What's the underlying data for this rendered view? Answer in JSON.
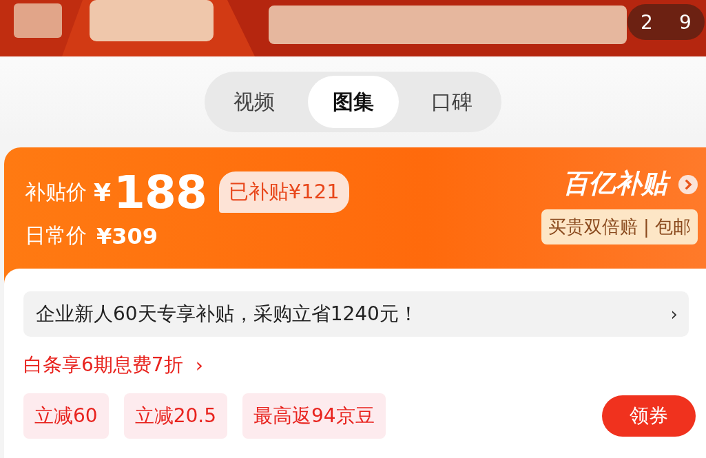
{
  "banner": {
    "kind": "picture",
    "counter": {
      "current": "2",
      "total": "9"
    }
  },
  "tabs": [
    {
      "label": "视频",
      "selected": false
    },
    {
      "label": "图集",
      "selected": true
    },
    {
      "label": "口碑",
      "selected": false
    }
  ],
  "price_card": {
    "subsidy_label": "补贴价",
    "currency": "¥",
    "subsidy_price": "188",
    "subsidized_tag": "已补贴¥121",
    "daily_label": "日常价",
    "daily_price": "¥309",
    "brand": "百亿补贴",
    "guarantee": "买贵双倍赔 | 包邮"
  },
  "promo_bar": {
    "text": "企业新人60天专享补贴，采购立省1240元！",
    "chevron": "›"
  },
  "installment": {
    "text": "白条享6期息费7折",
    "chevron": "›"
  },
  "coupons": [
    "立减60",
    "立减20.5",
    "最高返94京豆"
  ],
  "coupon_button": "领券"
}
